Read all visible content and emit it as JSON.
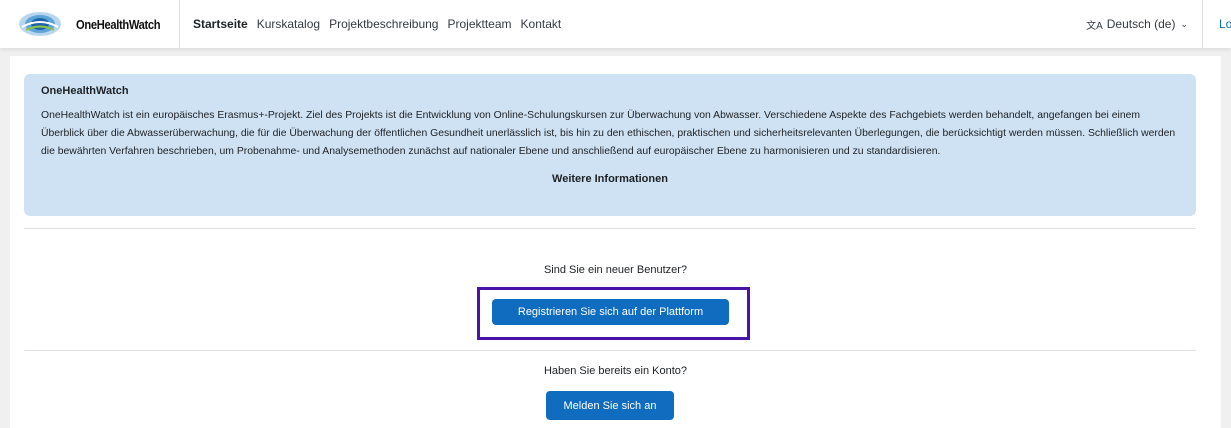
{
  "navbar": {
    "brand_name": "OneHealthWatch",
    "links": [
      {
        "label": "Startseite",
        "active": true
      },
      {
        "label": "Kurskatalog",
        "active": false
      },
      {
        "label": "Projektbeschreibung",
        "active": false
      },
      {
        "label": "Projektteam",
        "active": false
      },
      {
        "label": "Kontakt",
        "active": false
      }
    ],
    "language": "Deutsch (de)",
    "login_partial": "Lo"
  },
  "info": {
    "title": "OneHealthWatch",
    "text": "OneHealthWatch ist ein europäisches Erasmus+-Projekt. Ziel des Projekts ist die Entwicklung von Online-Schulungskursen zur Überwachung von Abwasser. Verschiedene Aspekte des Fachgebiets werden behandelt, angefangen bei einem Überblick über die Abwasserüberwachung, die für die Überwachung der öffentlichen Gesundheit unerlässlich ist, bis hin zu den ethischen, praktischen und sicherheitsrelevanten Überlegungen, die berücksichtigt werden müssen. Schließlich werden die bewährten Verfahren beschrieben, um Probenahme- und Analysemethoden zunächst auf nationaler Ebene und anschließend auf europäischer Ebene zu harmonisieren und zu standardisieren.",
    "more_label": "Weitere Informationen"
  },
  "signup": {
    "question": "Sind Sie ein neuer Benutzer?",
    "button": "Registrieren Sie sich auf der Plattform"
  },
  "login": {
    "question": "Haben Sie bereits ein Konto?",
    "button": "Melden Sie sich an"
  },
  "colors": {
    "primary": "#0f6cbf",
    "info_bg": "#cfe2f3",
    "highlight": "#4b12a8"
  }
}
